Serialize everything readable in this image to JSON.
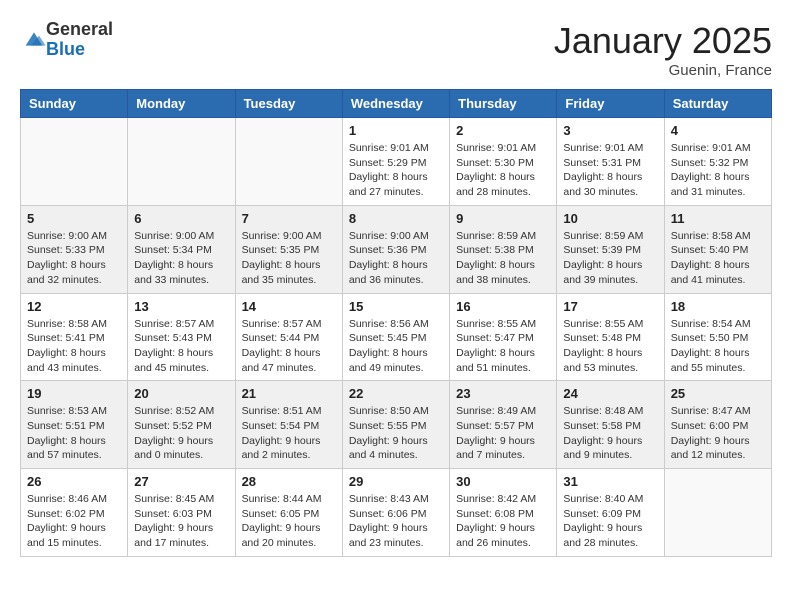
{
  "header": {
    "logo_general": "General",
    "logo_blue": "Blue",
    "month_title": "January 2025",
    "location": "Guenin, France"
  },
  "days_of_week": [
    "Sunday",
    "Monday",
    "Tuesday",
    "Wednesday",
    "Thursday",
    "Friday",
    "Saturday"
  ],
  "weeks": [
    [
      {
        "day": "",
        "info": ""
      },
      {
        "day": "",
        "info": ""
      },
      {
        "day": "",
        "info": ""
      },
      {
        "day": "1",
        "info": "Sunrise: 9:01 AM\nSunset: 5:29 PM\nDaylight: 8 hours and 27 minutes."
      },
      {
        "day": "2",
        "info": "Sunrise: 9:01 AM\nSunset: 5:30 PM\nDaylight: 8 hours and 28 minutes."
      },
      {
        "day": "3",
        "info": "Sunrise: 9:01 AM\nSunset: 5:31 PM\nDaylight: 8 hours and 30 minutes."
      },
      {
        "day": "4",
        "info": "Sunrise: 9:01 AM\nSunset: 5:32 PM\nDaylight: 8 hours and 31 minutes."
      }
    ],
    [
      {
        "day": "5",
        "info": "Sunrise: 9:00 AM\nSunset: 5:33 PM\nDaylight: 8 hours and 32 minutes."
      },
      {
        "day": "6",
        "info": "Sunrise: 9:00 AM\nSunset: 5:34 PM\nDaylight: 8 hours and 33 minutes."
      },
      {
        "day": "7",
        "info": "Sunrise: 9:00 AM\nSunset: 5:35 PM\nDaylight: 8 hours and 35 minutes."
      },
      {
        "day": "8",
        "info": "Sunrise: 9:00 AM\nSunset: 5:36 PM\nDaylight: 8 hours and 36 minutes."
      },
      {
        "day": "9",
        "info": "Sunrise: 8:59 AM\nSunset: 5:38 PM\nDaylight: 8 hours and 38 minutes."
      },
      {
        "day": "10",
        "info": "Sunrise: 8:59 AM\nSunset: 5:39 PM\nDaylight: 8 hours and 39 minutes."
      },
      {
        "day": "11",
        "info": "Sunrise: 8:58 AM\nSunset: 5:40 PM\nDaylight: 8 hours and 41 minutes."
      }
    ],
    [
      {
        "day": "12",
        "info": "Sunrise: 8:58 AM\nSunset: 5:41 PM\nDaylight: 8 hours and 43 minutes."
      },
      {
        "day": "13",
        "info": "Sunrise: 8:57 AM\nSunset: 5:43 PM\nDaylight: 8 hours and 45 minutes."
      },
      {
        "day": "14",
        "info": "Sunrise: 8:57 AM\nSunset: 5:44 PM\nDaylight: 8 hours and 47 minutes."
      },
      {
        "day": "15",
        "info": "Sunrise: 8:56 AM\nSunset: 5:45 PM\nDaylight: 8 hours and 49 minutes."
      },
      {
        "day": "16",
        "info": "Sunrise: 8:55 AM\nSunset: 5:47 PM\nDaylight: 8 hours and 51 minutes."
      },
      {
        "day": "17",
        "info": "Sunrise: 8:55 AM\nSunset: 5:48 PM\nDaylight: 8 hours and 53 minutes."
      },
      {
        "day": "18",
        "info": "Sunrise: 8:54 AM\nSunset: 5:50 PM\nDaylight: 8 hours and 55 minutes."
      }
    ],
    [
      {
        "day": "19",
        "info": "Sunrise: 8:53 AM\nSunset: 5:51 PM\nDaylight: 8 hours and 57 minutes."
      },
      {
        "day": "20",
        "info": "Sunrise: 8:52 AM\nSunset: 5:52 PM\nDaylight: 9 hours and 0 minutes."
      },
      {
        "day": "21",
        "info": "Sunrise: 8:51 AM\nSunset: 5:54 PM\nDaylight: 9 hours and 2 minutes."
      },
      {
        "day": "22",
        "info": "Sunrise: 8:50 AM\nSunset: 5:55 PM\nDaylight: 9 hours and 4 minutes."
      },
      {
        "day": "23",
        "info": "Sunrise: 8:49 AM\nSunset: 5:57 PM\nDaylight: 9 hours and 7 minutes."
      },
      {
        "day": "24",
        "info": "Sunrise: 8:48 AM\nSunset: 5:58 PM\nDaylight: 9 hours and 9 minutes."
      },
      {
        "day": "25",
        "info": "Sunrise: 8:47 AM\nSunset: 6:00 PM\nDaylight: 9 hours and 12 minutes."
      }
    ],
    [
      {
        "day": "26",
        "info": "Sunrise: 8:46 AM\nSunset: 6:02 PM\nDaylight: 9 hours and 15 minutes."
      },
      {
        "day": "27",
        "info": "Sunrise: 8:45 AM\nSunset: 6:03 PM\nDaylight: 9 hours and 17 minutes."
      },
      {
        "day": "28",
        "info": "Sunrise: 8:44 AM\nSunset: 6:05 PM\nDaylight: 9 hours and 20 minutes."
      },
      {
        "day": "29",
        "info": "Sunrise: 8:43 AM\nSunset: 6:06 PM\nDaylight: 9 hours and 23 minutes."
      },
      {
        "day": "30",
        "info": "Sunrise: 8:42 AM\nSunset: 6:08 PM\nDaylight: 9 hours and 26 minutes."
      },
      {
        "day": "31",
        "info": "Sunrise: 8:40 AM\nSunset: 6:09 PM\nDaylight: 9 hours and 28 minutes."
      },
      {
        "day": "",
        "info": ""
      }
    ]
  ]
}
